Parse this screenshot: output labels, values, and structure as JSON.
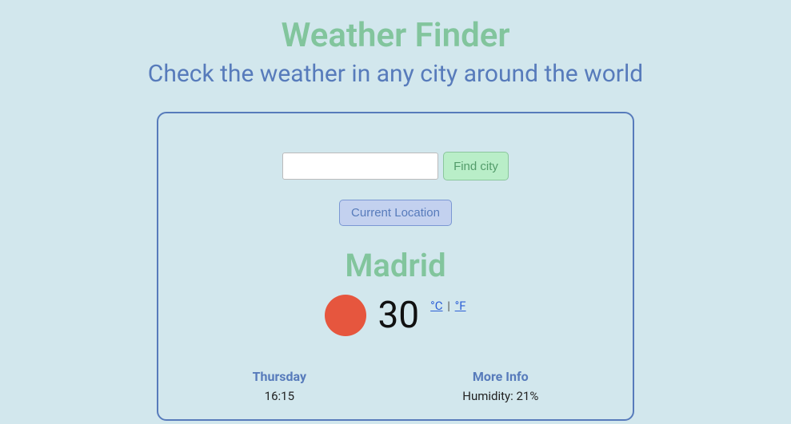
{
  "header": {
    "title": "Weather Finder",
    "subtitle": "Check the weather in any city around the world"
  },
  "search": {
    "input_value": "",
    "input_placeholder": "",
    "find_label": "Find city",
    "location_label": "Current Location"
  },
  "weather": {
    "city": "Madrid",
    "temperature": "30",
    "unit_c": "°C",
    "unit_sep": " | ",
    "unit_f": "°F",
    "icon_name": "sun-icon"
  },
  "details": {
    "day_heading": "Thursday",
    "time": "16:15",
    "more_heading": "More Info",
    "humidity": "Humidity: 21%"
  }
}
